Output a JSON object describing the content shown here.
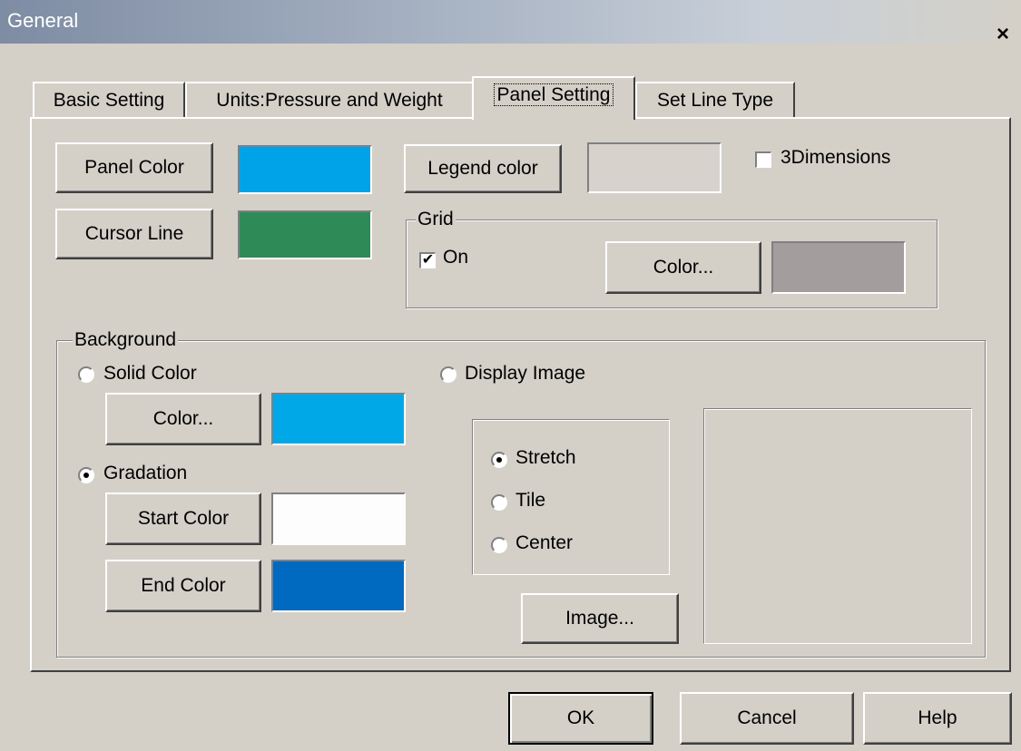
{
  "window": {
    "title": "General",
    "close_glyph": "×"
  },
  "tabs": [
    {
      "label": "Basic Setting"
    },
    {
      "label": "Units:Pressure and Weight"
    },
    {
      "label": "Panel Setting"
    },
    {
      "label": "Set Line Type"
    }
  ],
  "active_tab": "Panel Setting",
  "panel": {
    "panel_color_label": "Panel Color",
    "panel_color": "#00a2e8",
    "cursor_line_label": "Cursor Line",
    "cursor_line_color": "#2e8b57",
    "legend_color_label": "Legend color",
    "legend_color": "#d7d3cc",
    "three_d_label": "3Dimensions",
    "three_d_checked": false
  },
  "grid": {
    "group_label": "Grid",
    "on_label": "On",
    "on_checked": true,
    "check_glyph": "✔",
    "color_button_label": "Color...",
    "color": "#a39d9d"
  },
  "background": {
    "group_label": "Background",
    "solid_color_label": "Solid Color",
    "solid_selected": false,
    "solid_color_button_label": "Color...",
    "solid_color": "#00a8e8",
    "gradation_label": "Gradation",
    "gradation_selected": true,
    "start_color_label": "Start Color",
    "start_color": "#fdfdfd",
    "end_color_label": "End Color",
    "end_color": "#0069c0",
    "display_image_label": "Display Image",
    "display_image_selected": false,
    "image_mode_options": [
      {
        "label": "Stretch",
        "selected": true
      },
      {
        "label": "Tile",
        "selected": false
      },
      {
        "label": "Center",
        "selected": false
      }
    ],
    "image_button_label": "Image..."
  },
  "footer": {
    "ok_label": "OK",
    "cancel_label": "Cancel",
    "help_label": "Help"
  }
}
